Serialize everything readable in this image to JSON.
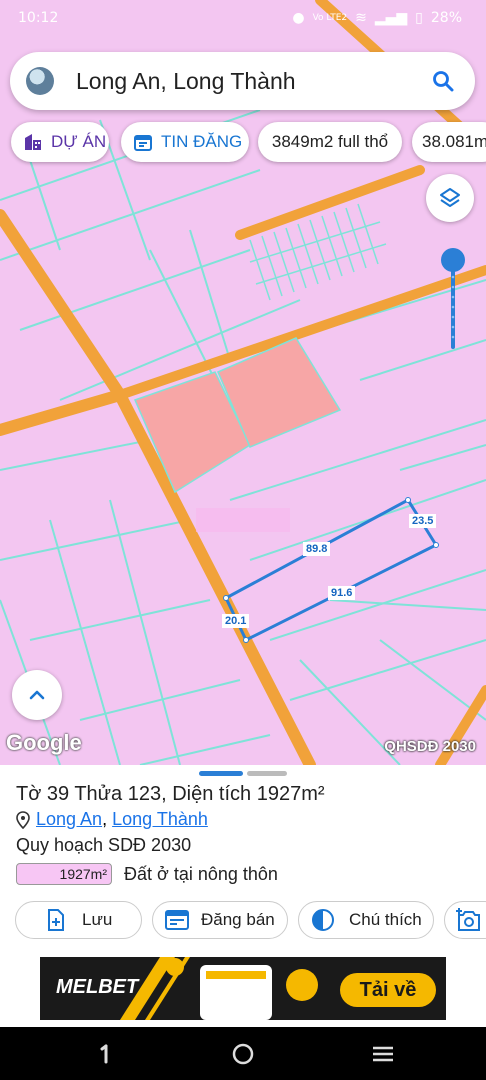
{
  "status_bar": {
    "time": "10:12",
    "battery": "28%",
    "network": "Vo LTE2"
  },
  "search": {
    "query": "Long An, Long Thành"
  },
  "chips": [
    {
      "label": "DỰ ÁN"
    },
    {
      "label": "TIN ĐĂNG"
    },
    {
      "label": "3849m2 full thổ"
    },
    {
      "label": "38.081m"
    }
  ],
  "map": {
    "google_label": "Google",
    "plan_label": "QHSDĐ 2030",
    "measurements": {
      "top": "89.8",
      "right": "23.5",
      "bottom": "91.6",
      "left": "20.1"
    }
  },
  "parcel": {
    "title": "Tờ 39 Thửa 123, Diện tích 1927m²",
    "province": "Long An",
    "district": "Long Thành",
    "separator": ",",
    "plan_title": "Quy hoạch SDĐ 2030",
    "legend_area": "1927m²",
    "legend_type": "Đất ở tại nông thôn"
  },
  "actions": {
    "save": "Lưu",
    "post": "Đăng bán",
    "legend": "Chú thích"
  },
  "ad": {
    "brand": "MELBET",
    "cta": "Tải về"
  },
  "colors": {
    "map_background": "#f3c6f1",
    "road": "#f1a23a",
    "highlight": "#f7a6a6",
    "boundary": "#2b7fd6",
    "parcel_lines": "#7fe3d8"
  }
}
